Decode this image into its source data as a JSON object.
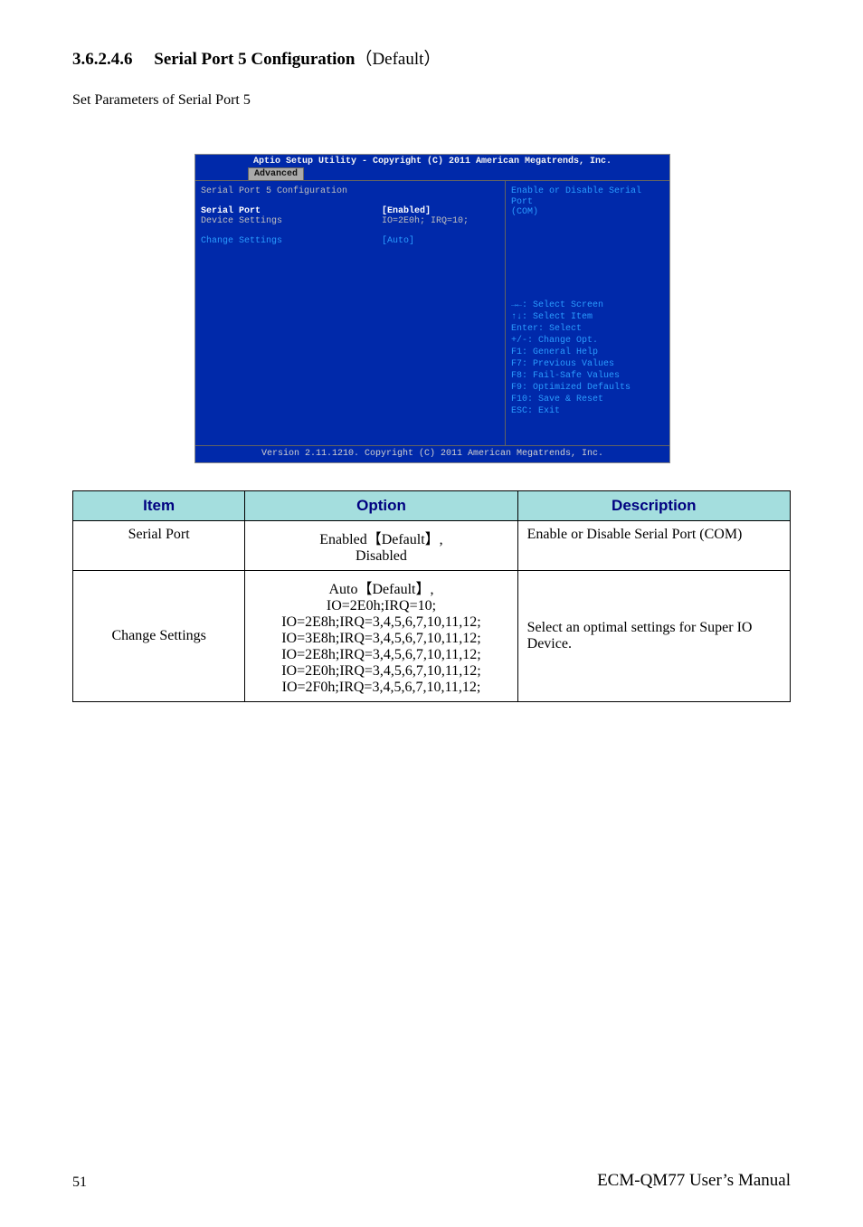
{
  "section": {
    "num": "3.6.2.4.6",
    "title_prefix": "Serial Port 5 Configuration",
    "title_suffix": "（Default）",
    "desc": "Set Parameters of Serial Port 5"
  },
  "bios": {
    "titlebar": "Aptio Setup Utility - Copyright (C) 2011 American Megatrends, Inc.",
    "tab": "Advanced",
    "heading": "Serial Port 5 Configuration",
    "rows": {
      "serial_port": {
        "label": "Serial Port",
        "value": "[Enabled]"
      },
      "device_settings": {
        "label": "Device Settings",
        "value": "IO=2E0h; IRQ=10;"
      },
      "change_settings": {
        "label": "Change Settings",
        "value": "[Auto]"
      }
    },
    "help_top": [
      "Enable or Disable Serial Port",
      "(COM)"
    ],
    "help_keys": [
      "→←: Select Screen",
      "↑↓: Select Item",
      "Enter: Select",
      "+/-: Change Opt.",
      "F1: General Help",
      "F7: Previous Values",
      "F8: Fail-Safe Values",
      "F9: Optimized Defaults",
      "F10: Save & Reset",
      "ESC: Exit"
    ],
    "footer": "Version 2.11.1210. Copyright (C) 2011 American Megatrends, Inc."
  },
  "table": {
    "headers": {
      "item": "Item",
      "option": "Option",
      "desc": "Description"
    },
    "rows": [
      {
        "item": "Serial Port",
        "option_top": "Enabled【Default】,",
        "option_bottom": "Disabled",
        "desc": "Enable or Disable Serial Port (COM)"
      },
      {
        "item": "Change Settings",
        "option_lines": [
          "Auto【Default】,",
          "IO=2E0h;IRQ=10;",
          "IO=2E8h;IRQ=3,4,5,6,7,10,11,12;",
          "IO=3E8h;IRQ=3,4,5,6,7,10,11,12;",
          "IO=2E8h;IRQ=3,4,5,6,7,10,11,12;",
          "IO=2E0h;IRQ=3,4,5,6,7,10,11,12;",
          "IO=2F0h;IRQ=3,4,5,6,7,10,11,12;"
        ],
        "desc": "Select an optimal settings for Super IO Device."
      }
    ]
  },
  "footer": {
    "page": "51",
    "manual": "ECM-QM77 User’s Manual"
  }
}
